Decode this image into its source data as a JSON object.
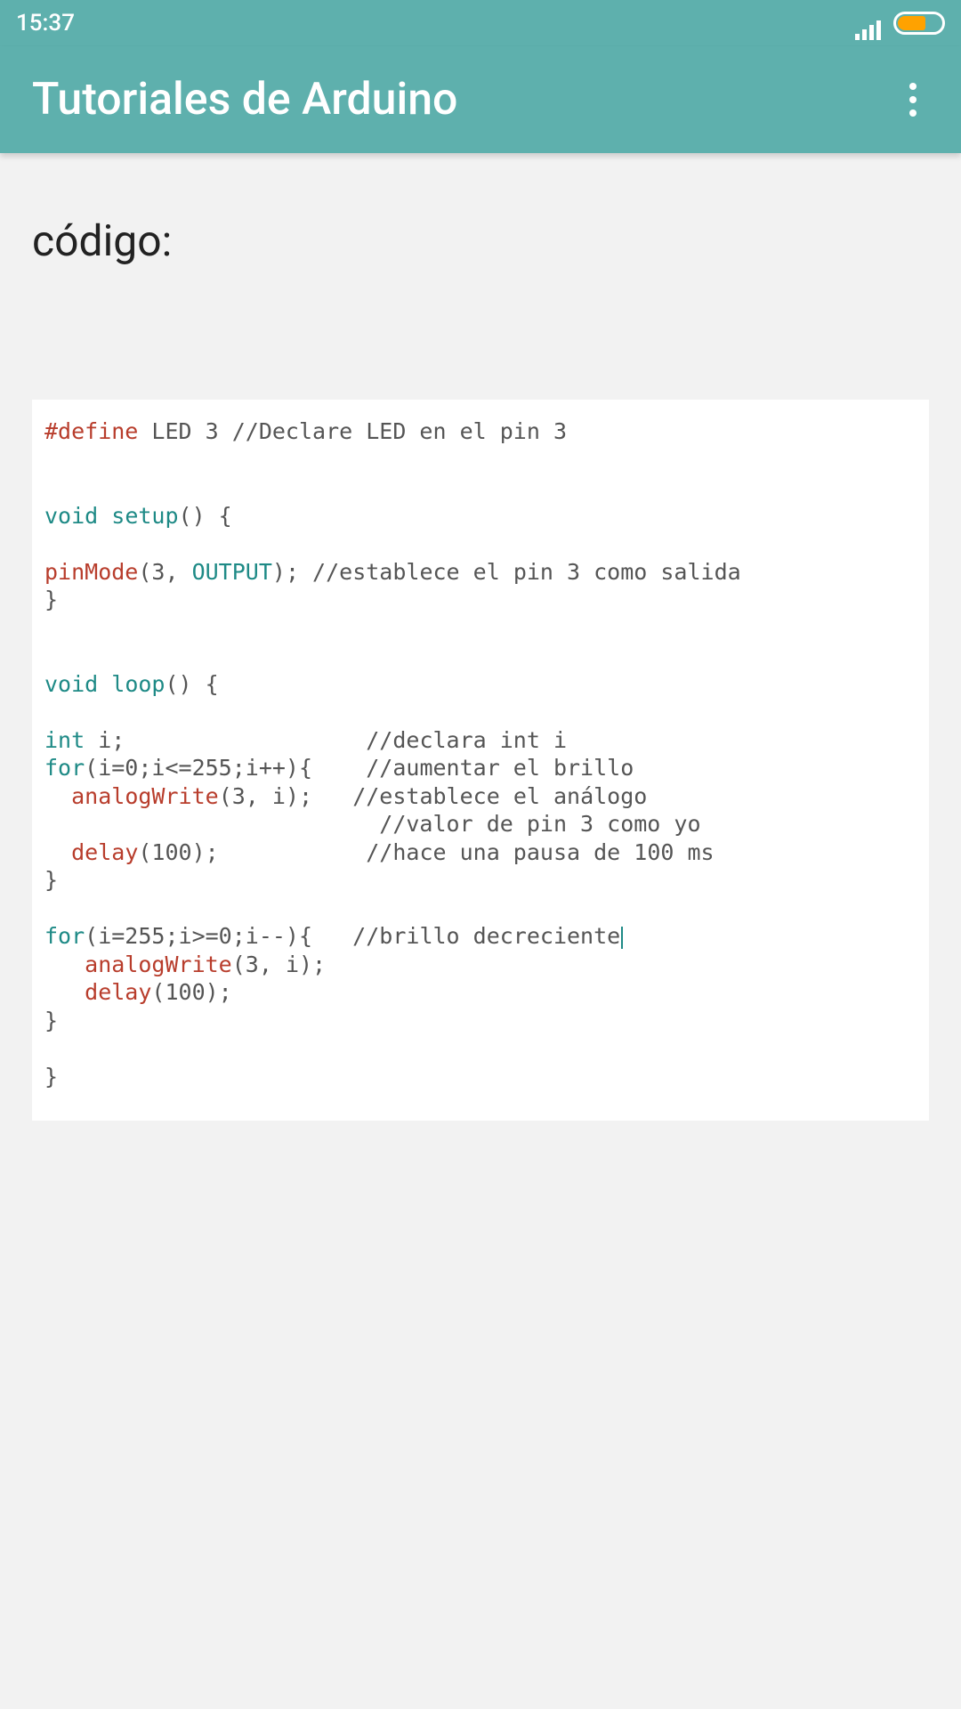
{
  "status": {
    "time": "15:37"
  },
  "appbar": {
    "title": "Tutoriales de Arduino"
  },
  "page": {
    "heading": "código:"
  },
  "code": {
    "l1_define": "#define",
    "l1_rest": " LED 3 //Declare LED en el pin 3",
    "l3_void": "void",
    "l3_setup": " setup",
    "l3_rest": "() {",
    "l5_pinmode": "pinMode",
    "l5_mid": "(3, ",
    "l5_output": "OUTPUT",
    "l5_rest": "); //establece el pin 3 como salida",
    "l6_brace": "}",
    "l8_void": "void",
    "l8_loop": " loop",
    "l8_rest": "() {",
    "l10_int_kw": "int",
    "l10_rest": " i;                  //declara int i",
    "l11_for": "for",
    "l11_rest": "(i=0;i<=255;i++){    //aumentar el brillo",
    "l12_pad": "  ",
    "l12_aw": "analogWrite",
    "l12_rest": "(3, i);   //establece el análogo",
    "l13": "                         //valor de pin 3 como yo",
    "l14_pad": "  ",
    "l14_delay": "delay",
    "l14_rest": "(100);           //hace una pausa de 100 ms",
    "l15_brace": "}",
    "l17_for": "for",
    "l17_rest": "(i=255;i>=0;i--){   //brillo decreciente",
    "l18_pad": "   ",
    "l18_aw": "analogWrite",
    "l18_rest": "(3, i);",
    "l19_pad": "   ",
    "l19_delay": "delay",
    "l19_rest": "(100);",
    "l20_brace": "}",
    "l22_brace": "}"
  }
}
